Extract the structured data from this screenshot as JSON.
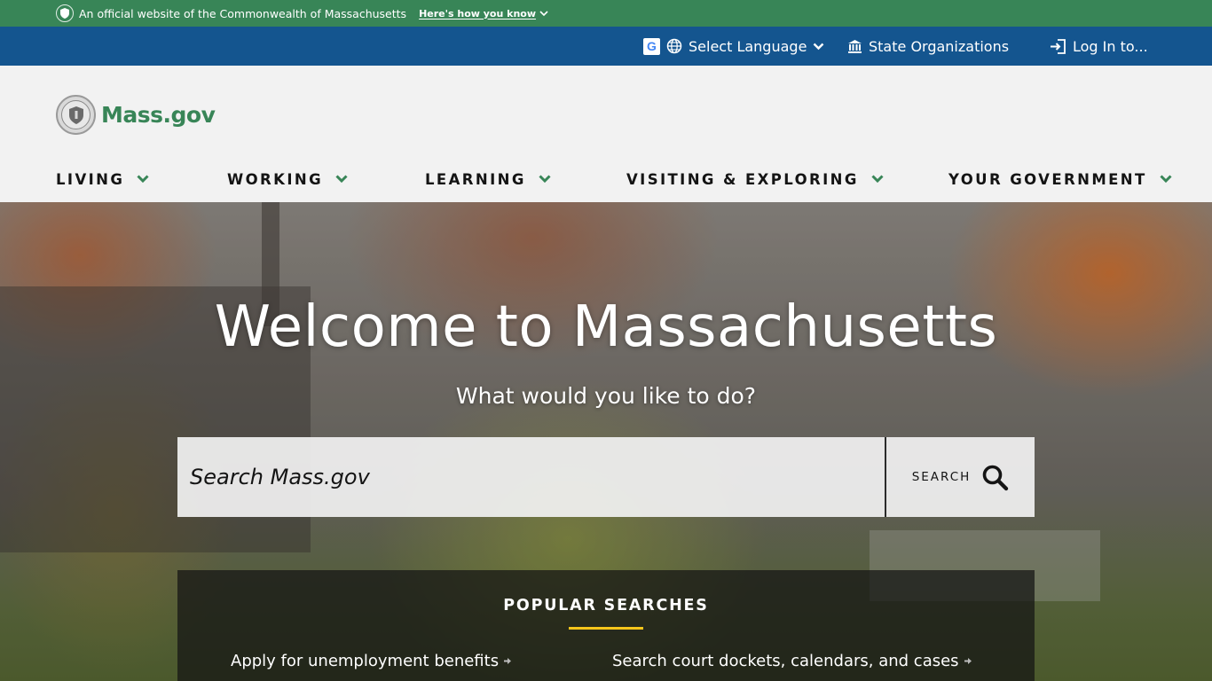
{
  "gov_banner": {
    "text": "An official website of the Commonwealth of Massachusetts",
    "how_link": "Here's how you know"
  },
  "utility_nav": {
    "language": "Select Language",
    "state_orgs": "State Organizations",
    "login": "Log In to..."
  },
  "header": {
    "logo_text": "Mass.gov",
    "nav": [
      {
        "label": "LIVING"
      },
      {
        "label": "WORKING"
      },
      {
        "label": "LEARNING"
      },
      {
        "label": "VISITING & EXPLORING"
      },
      {
        "label": "YOUR GOVERNMENT"
      }
    ]
  },
  "hero": {
    "title": "Welcome to Massachusetts",
    "subtitle": "What would you like to do?",
    "search_placeholder": "Search Mass.gov",
    "search_button": "SEARCH"
  },
  "popular": {
    "heading": "POPULAR SEARCHES",
    "links": [
      {
        "label": "Apply for unemployment benefits"
      },
      {
        "label": "Search court dockets, calendars, and cases"
      }
    ]
  },
  "colors": {
    "gov_banner": "#388557",
    "utility_bar": "#14558f",
    "header_bg": "#f2f2f2",
    "brand_green": "#388557",
    "accent_gold": "#f6c51b"
  },
  "icons": [
    "seal-icon",
    "chevron-down-icon",
    "google-icon",
    "globe-icon",
    "building-icon",
    "login-icon",
    "search-icon",
    "arrow-right-icon"
  ]
}
